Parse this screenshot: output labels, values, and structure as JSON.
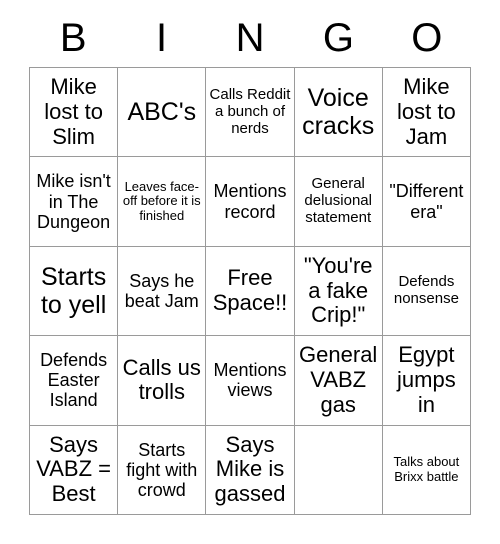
{
  "card": {
    "header_letters": [
      "B",
      "I",
      "N",
      "G",
      "O"
    ],
    "squares": [
      {
        "text": "Mike lost to Slim",
        "size": "lg"
      },
      {
        "text": "ABC's",
        "size": "xl"
      },
      {
        "text": "Calls Reddit a bunch of nerds",
        "size": "sm"
      },
      {
        "text": "Voice cracks",
        "size": "xl"
      },
      {
        "text": "Mike lost to Jam",
        "size": "lg"
      },
      {
        "text": "Mike isn't in The Dungeon",
        "size": "md"
      },
      {
        "text": "Leaves face-off before it is finished",
        "size": "xs"
      },
      {
        "text": "Mentions record",
        "size": "md"
      },
      {
        "text": "General delusional statement",
        "size": "sm"
      },
      {
        "text": "\"Different era\"",
        "size": "md"
      },
      {
        "text": "Starts to yell",
        "size": "xl"
      },
      {
        "text": "Says he beat Jam",
        "size": "md"
      },
      {
        "text": "Free Space!!",
        "size": "lg"
      },
      {
        "text": "\"You're a fake Crip!\"",
        "size": "lg"
      },
      {
        "text": "Defends nonsense",
        "size": "sm"
      },
      {
        "text": "Defends Easter Island",
        "size": "md"
      },
      {
        "text": "Calls us trolls",
        "size": "lg"
      },
      {
        "text": "Mentions views",
        "size": "md"
      },
      {
        "text": "General VABZ gas",
        "size": "lg"
      },
      {
        "text": "Egypt jumps in",
        "size": "lg"
      },
      {
        "text": "Says VABZ = Best",
        "size": "lg"
      },
      {
        "text": "Starts fight with crowd",
        "size": "md"
      },
      {
        "text": "Says Mike is gassed",
        "size": "lg"
      },
      {
        "text": "",
        "size": "md"
      },
      {
        "text": "Talks about Brixx battle",
        "size": "xs"
      }
    ]
  }
}
